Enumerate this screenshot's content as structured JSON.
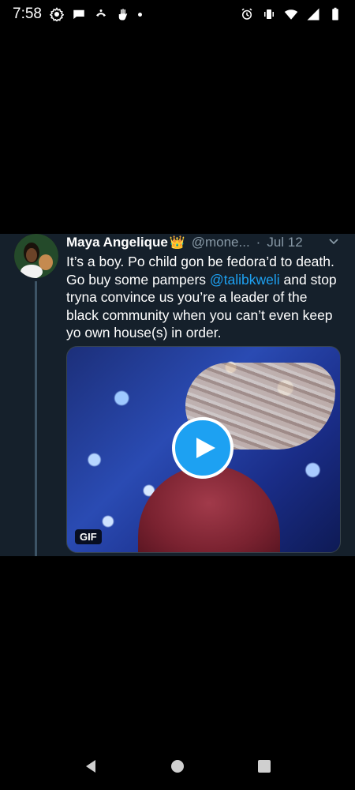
{
  "status_bar": {
    "time": "7:58",
    "left_icons": [
      "settings-icon",
      "chat-bubble-icon",
      "call-icon",
      "hand-icon",
      "dot-icon"
    ],
    "right_icons": [
      "alarm-icon",
      "vibrate-icon",
      "wifi-icon",
      "signal-icon",
      "battery-icon"
    ]
  },
  "tweet": {
    "display_name": "Maya Angelique",
    "name_emoji": "👑",
    "handle": "@mone...",
    "separator": "·",
    "date": "Jul 12",
    "text_part1": "It’s a boy. Po child gon be fedora’d to death. Go buy some pampers ",
    "mention": "@talibkweli",
    "text_part2": " and stop tryna convince us you’re a leader of the black community when you can’t even keep yo own house(s) in order.",
    "media": {
      "badge": "GIF"
    }
  },
  "colors": {
    "background": "#000000",
    "card": "#15202b",
    "accent": "#1da1f2",
    "muted": "#8899a6"
  }
}
